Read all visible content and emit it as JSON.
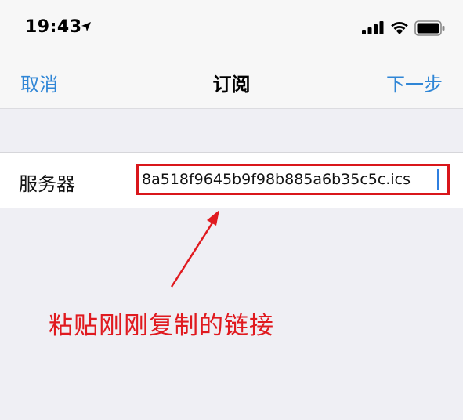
{
  "status_bar": {
    "time": "19:43",
    "icons": [
      "location-arrow-icon",
      "signal-icon",
      "wifi-icon",
      "battery-icon"
    ]
  },
  "nav": {
    "cancel_label": "取消",
    "title": "订阅",
    "next_label": "下一步"
  },
  "form": {
    "server_label": "服务器",
    "server_value": "8a518f9645b9f98b885a6b35c5c.ics"
  },
  "annotation": {
    "text": "粘贴刚刚复制的链接"
  },
  "colors": {
    "accent": "#2f86d6",
    "annotation_red": "#e01a1f",
    "background": "#efeff4"
  }
}
